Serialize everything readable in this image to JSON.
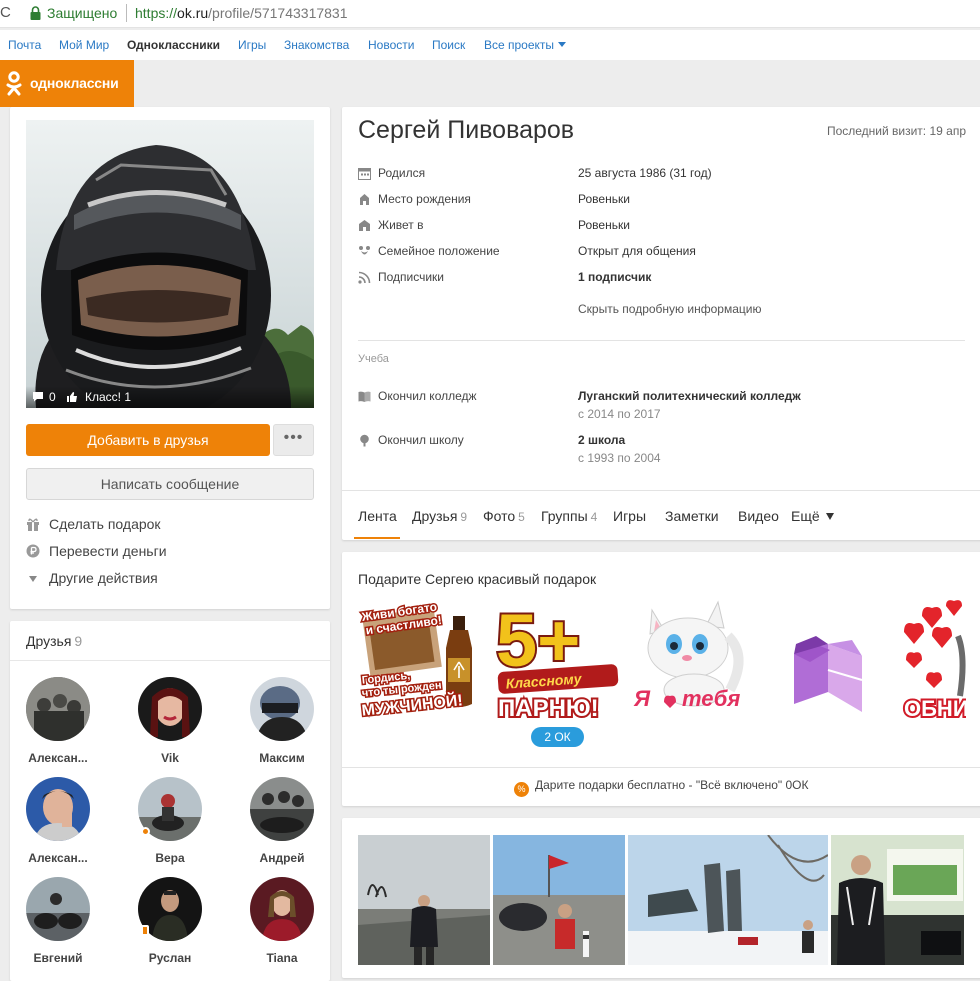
{
  "browser": {
    "secure_label": "Защищено",
    "url_scheme": "https://",
    "url_host": "ok.ru",
    "url_path": "/profile/571743317831"
  },
  "portal_nav": {
    "items": [
      "Почта",
      "Мой Мир",
      "Одноклассники",
      "Игры",
      "Знакомства",
      "Новости",
      "Поиск",
      "Все проекты"
    ],
    "active": "Одноклассники"
  },
  "logo": {
    "text": "одноклассни"
  },
  "avatar": {
    "comments": "0",
    "likes": "Класс! 1"
  },
  "actions": {
    "add_friend": "Добавить в друзья",
    "more": "•••",
    "send_message": "Написать сообщение",
    "links": [
      "Сделать подарок",
      "Перевести деньги",
      "Другие действия"
    ]
  },
  "friends": {
    "title": "Друзья",
    "count": "9",
    "items": [
      {
        "name": "Алексан..."
      },
      {
        "name": "Vik"
      },
      {
        "name": "Максим"
      },
      {
        "name": "Алексан..."
      },
      {
        "name": "Вера"
      },
      {
        "name": "Андрей"
      },
      {
        "name": "Евгений"
      },
      {
        "name": "Руслан"
      },
      {
        "name": "Tiana"
      }
    ]
  },
  "profile": {
    "name": "Сергей Пивоваров",
    "last_visit": "Последний визит: 19 апр",
    "info": [
      {
        "label": "Родился",
        "value": "25 августа 1986 (31 год)",
        "icon": "calendar-icon"
      },
      {
        "label": "Место рождения",
        "value": "Ровеньки",
        "icon": "location-icon"
      },
      {
        "label": "Живет в",
        "value": "Ровеньки",
        "icon": "home-icon"
      },
      {
        "label": "Семейное положение",
        "value": "Открыт для общения",
        "icon": "relationship-icon"
      },
      {
        "label": "Подписчики",
        "value": "1 подписчик",
        "icon": "rss-icon"
      }
    ],
    "hide_info": "Скрыть подробную информацию",
    "education_title": "Учеба",
    "education": [
      {
        "label": "Окончил колледж",
        "value": "Луганский политехнический колледж",
        "years": "с 2014 по 2017",
        "icon": "book-icon"
      },
      {
        "label": "Окончил школу",
        "value": "2 школа",
        "years": "с 1993 по 2004",
        "icon": "school-icon"
      }
    ]
  },
  "tabs": [
    {
      "label": "Лента",
      "count": ""
    },
    {
      "label": "Друзья",
      "count": "9"
    },
    {
      "label": "Фото",
      "count": "5"
    },
    {
      "label": "Группы",
      "count": "4"
    },
    {
      "label": "Игры",
      "count": ""
    },
    {
      "label": "Заметки",
      "count": ""
    },
    {
      "label": "Видео",
      "count": ""
    },
    {
      "label": "Ещё",
      "count": ""
    }
  ],
  "gifts": {
    "title": "Подарите Сергею красивый подарок",
    "card1": {
      "line1": "Живи богато",
      "line2": "и счастливо!",
      "line3": "Гордись,",
      "line4": "что ты рожден",
      "line5": "МУЖЧИНОЙ!"
    },
    "card2": {
      "big": "5+",
      "line1": "Классному",
      "line2": "ПАРНЮ!"
    },
    "card3": {
      "line1": "Я",
      "line2": "тебя"
    },
    "card5": {
      "text": "ОБНИ"
    },
    "price_badge": "2 ОК",
    "free_text": "Дарите подарки бесплатно - \"Всё включено\" 0ОК",
    "free_icon": "%"
  },
  "colors": {
    "accent": "#ee8208",
    "link": "#2a79c4",
    "badge": "#2a9cdc"
  }
}
